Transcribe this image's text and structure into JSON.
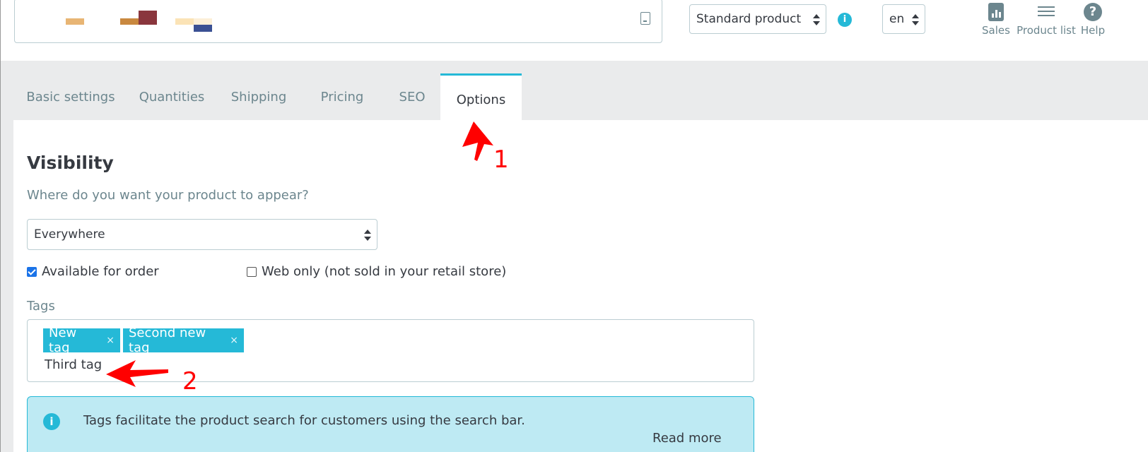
{
  "header": {
    "product_type": "Standard product",
    "language": "en",
    "links": [
      {
        "label": "Sales",
        "icon": "chart-icon"
      },
      {
        "label": "Product list",
        "icon": "list-icon"
      },
      {
        "label": "Help",
        "icon": "help-icon"
      }
    ]
  },
  "tabs": [
    {
      "label": "Basic settings"
    },
    {
      "label": "Quantities"
    },
    {
      "label": "Shipping"
    },
    {
      "label": "Pricing"
    },
    {
      "label": "SEO"
    },
    {
      "label": "Options",
      "active": true
    }
  ],
  "visibility": {
    "title": "Visibility",
    "question": "Where do you want your product to appear?",
    "selected": "Everywhere",
    "available_for_order": {
      "label": "Available for order",
      "checked": true
    },
    "web_only": {
      "label": "Web only (not sold in your retail store)",
      "checked": false
    }
  },
  "tags": {
    "label": "Tags",
    "items": [
      "New tag",
      "Second new tag"
    ],
    "remove_symbol": "×",
    "input_value": "Third tag"
  },
  "alert": {
    "text": "Tags facilitate the product search for customers using the search bar.",
    "link": "Read more"
  },
  "annotations": {
    "arrow1_label": "1",
    "arrow2_label": "2",
    "color": "#ff0000"
  },
  "colors": {
    "accent": "#25b9d7",
    "text": "#363a41",
    "muted": "#6c868e"
  }
}
